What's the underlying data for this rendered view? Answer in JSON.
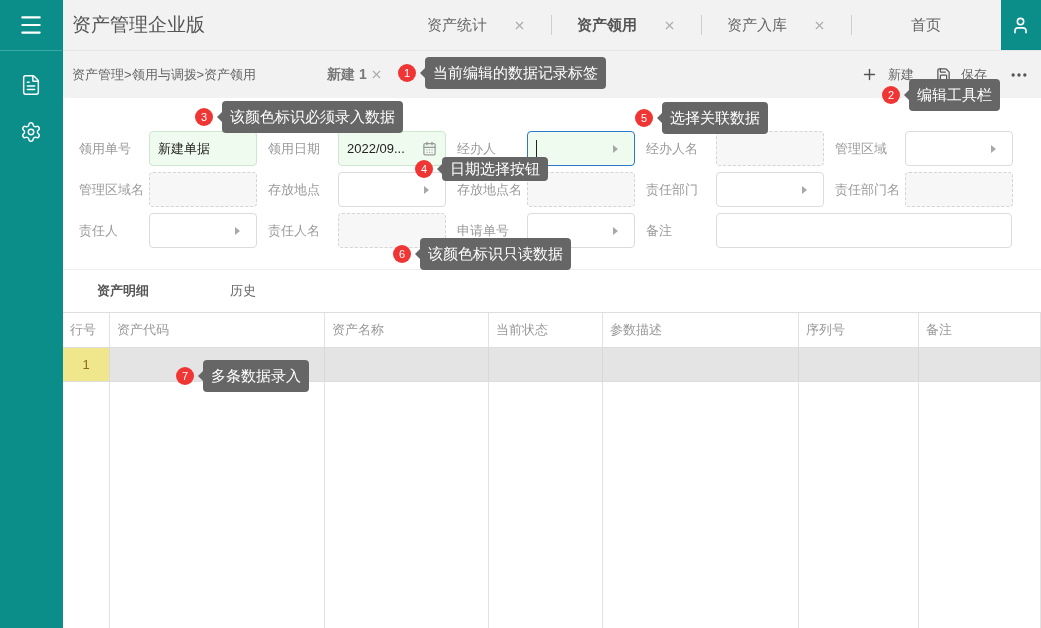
{
  "app_title": "资产管理企业版",
  "tabs": [
    {
      "label": "资产统计",
      "selected": false,
      "closable": true
    },
    {
      "label": "资产领用",
      "selected": true,
      "closable": true
    },
    {
      "label": "资产入库",
      "selected": false,
      "closable": true
    },
    {
      "label": "首页",
      "selected": false,
      "closable": false
    }
  ],
  "breadcrumb": "资产管理>领用与调拨>资产领用",
  "record_tab": {
    "label": "新建 1"
  },
  "toolbar": [
    {
      "kind": "new",
      "label": "新建"
    },
    {
      "kind": "save",
      "label": "保存"
    },
    {
      "kind": "more"
    }
  ],
  "form": {
    "fields": [
      {
        "label": "领用单号",
        "kind": "text",
        "required": true,
        "focused": false,
        "value": "新建单据"
      },
      {
        "label": "领用日期",
        "kind": "date",
        "required": true,
        "focused": false,
        "value": "2022/09..."
      },
      {
        "label": "经办人",
        "kind": "lookup",
        "required": true,
        "focused": true
      },
      {
        "label": "经办人名",
        "kind": "readonly",
        "required": false,
        "focused": false
      },
      {
        "label": "管理区域",
        "kind": "lookup",
        "required": false,
        "focused": false
      },
      {
        "label": "管理区域名",
        "kind": "readonly",
        "required": false,
        "focused": false
      },
      {
        "label": "存放地点",
        "kind": "lookup",
        "required": false,
        "focused": false
      },
      {
        "label": "存放地点名",
        "kind": "readonly",
        "required": false,
        "focused": false
      },
      {
        "label": "责任部门",
        "kind": "lookup",
        "required": false,
        "focused": false
      },
      {
        "label": "责任部门名",
        "kind": "readonly",
        "required": false,
        "focused": false
      },
      {
        "label": "责任人",
        "kind": "lookup",
        "required": false,
        "focused": false
      },
      {
        "label": "责任人名",
        "kind": "readonly",
        "required": false,
        "focused": false
      },
      {
        "label": "申请单号",
        "kind": "lookup",
        "required": false,
        "focused": false
      },
      {
        "label": "备注",
        "kind": "wide",
        "required": false,
        "focused": false
      }
    ]
  },
  "detail_tabs": [
    {
      "label": "资产明细",
      "selected": true
    },
    {
      "label": "历史",
      "selected": false
    }
  ],
  "table": {
    "columns": [
      "行号",
      "资产代码",
      "资产名称",
      "当前状态",
      "参数描述",
      "序列号",
      "备注"
    ],
    "rows": [
      {
        "cells": [
          "1"
        ],
        "selected": true
      }
    ]
  },
  "callouts": [
    {
      "number": "1",
      "text": "当前编辑的数据记录标签"
    },
    {
      "number": "2",
      "text": "编辑工具栏"
    },
    {
      "number": "3",
      "text": "该颜色标识必须录入数据"
    },
    {
      "number": "4",
      "text": "日期选择按钮"
    },
    {
      "number": "5",
      "text": "选择关联数据"
    },
    {
      "number": "6",
      "text": "该颜色标识只读数据"
    },
    {
      "number": "7",
      "text": "多条数据录入"
    }
  ]
}
